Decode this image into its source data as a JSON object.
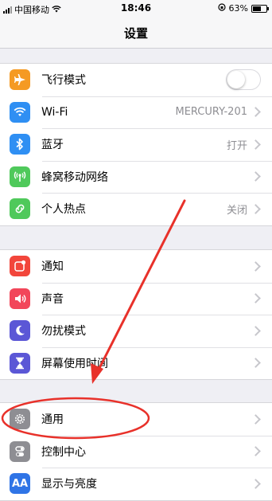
{
  "status_bar": {
    "carrier": "中国移动",
    "time": "18:46",
    "battery_percent": "63%",
    "battery_level": 0.63,
    "wifi_icon": "wifi-icon",
    "lock_icon": "orientation-lock-icon"
  },
  "nav": {
    "title": "设置"
  },
  "groups": [
    {
      "rows": [
        {
          "label": "飞行模式",
          "icon": "airplane-icon",
          "icon_color": "#f59a23",
          "control": "toggle",
          "toggle_on": false
        },
        {
          "label": "Wi-Fi",
          "icon": "wifi-icon",
          "icon_color": "#2f8ff3",
          "value": "MERCURY-201"
        },
        {
          "label": "蓝牙",
          "icon": "bluetooth-icon",
          "icon_color": "#2f8ff3",
          "value": "打开"
        },
        {
          "label": "蜂窝移动网络",
          "icon": "cellular-icon",
          "icon_color": "#4fc95b"
        },
        {
          "label": "个人热点",
          "icon": "hotspot-icon",
          "icon_color": "#4fc95b",
          "value": "关闭"
        }
      ]
    },
    {
      "rows": [
        {
          "label": "通知",
          "icon": "notifications-icon",
          "icon_color": "#f2463b"
        },
        {
          "label": "声音",
          "icon": "sounds-icon",
          "icon_color": "#f2465a"
        },
        {
          "label": "勿扰模式",
          "icon": "moon-icon",
          "icon_color": "#5b57d6"
        },
        {
          "label": "屏幕使用时间",
          "icon": "hourglass-icon",
          "icon_color": "#5b57d6"
        }
      ]
    },
    {
      "rows": [
        {
          "label": "通用",
          "icon": "gear-icon",
          "icon_color": "#8e8e93"
        },
        {
          "label": "控制中心",
          "icon": "control-center-icon",
          "icon_color": "#8e8e93"
        },
        {
          "label": "显示与亮度",
          "icon": "display-icon",
          "icon_color": "#2f74e6"
        }
      ]
    }
  ],
  "annotation": {
    "color": "#e8312a"
  }
}
